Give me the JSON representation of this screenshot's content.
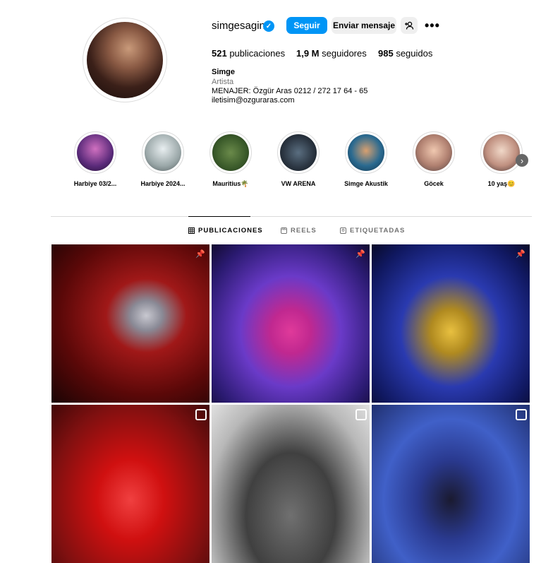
{
  "profile": {
    "username": "simgesagin",
    "follow_label": "Seguir",
    "message_label": "Enviar mensaje",
    "add_friend_icon": "add-person-icon",
    "more_icon": "•••",
    "stats": {
      "posts_count": "521",
      "posts_label": "publicaciones",
      "followers_count": "1,9 M",
      "followers_label": "seguidores",
      "following_count": "985",
      "following_label": "seguidos"
    },
    "bio": {
      "name": "Simge",
      "category": "Artista",
      "line1": "MENAJER: Özgür Aras 0212 / 272 17 64 - 65",
      "line2": "iletisim@ozguraras.com"
    }
  },
  "highlights": [
    {
      "label": "Harbiye 03/2..."
    },
    {
      "label": "Harbiye 2024..."
    },
    {
      "label": "Mauritius🌴"
    },
    {
      "label": "VW ARENA"
    },
    {
      "label": "Simge Akustik"
    },
    {
      "label": "Göcek"
    },
    {
      "label": "10 yaş😊"
    }
  ],
  "tabs": [
    {
      "label": "PUBLICACIONES",
      "active": true
    },
    {
      "label": "REELS",
      "active": false
    },
    {
      "label": "ETIQUETADAS",
      "active": false
    }
  ],
  "colors": {
    "accent": "#0095f6",
    "button_secondary": "#efefef",
    "muted_text": "#737373",
    "divider": "#dbdbdb"
  }
}
